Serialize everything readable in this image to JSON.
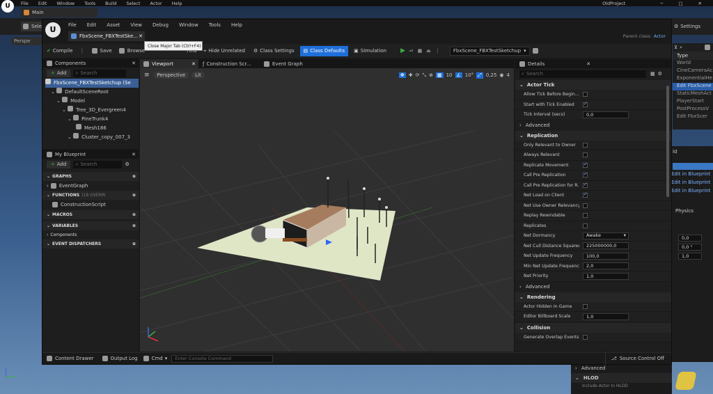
{
  "outer": {
    "menu": [
      "File",
      "Edit",
      "Window",
      "Tools",
      "Build",
      "Select",
      "Actor",
      "Help"
    ],
    "project": "OldProject",
    "tab": "Main",
    "select_label": "Sele",
    "perspective_label": "Perspe",
    "settings_label": "Settings",
    "outliner_header": "Type",
    "outliner_types": [
      "World",
      "CineCameraAc",
      "ExponentialHe",
      "Edit FbxScene",
      "StaticMeshAct",
      "PlayerStart",
      "PostProcessV",
      "Edit FbxScer"
    ],
    "right_labels": [
      "ld",
      "Edit in Blueprint",
      "Edit in Blueprint",
      "Edit in Blueprint",
      "Physics"
    ],
    "transform_values": [
      "0,0",
      "0,0 °",
      "1,0"
    ],
    "bottom_rows": [
      "Advanced",
      "HLOD",
      "Include Actor In HLOD"
    ]
  },
  "bp": {
    "menu": [
      "File",
      "Edit",
      "Asset",
      "View",
      "Debug",
      "Window",
      "Tools",
      "Help"
    ],
    "tab_title": "FbxScene_FBXTestSke...",
    "tooltip": "Close Major Tab (Ctrl+F4)",
    "parent_class_label": "Parent class:",
    "parent_class": "Actor",
    "toolbar": [
      "Compile",
      "Save",
      "Browse",
      "Find",
      "Hide Unrelated",
      "Class Settings",
      "Class Defaults",
      "Simulation"
    ],
    "debug_target": "FbxScene_FBXTestSketchup",
    "components": {
      "title": "Components",
      "add": "Add",
      "search": "Search",
      "tree": [
        "FbxScene_FBXTestSketchup (Se",
        "DefaultSceneRoot",
        "Model",
        "Tree_3D_Evergreen4",
        "PineTrunk4",
        "Mesh186",
        "Cluster_copy_007_3"
      ]
    },
    "myblueprint": {
      "title": "My Blueprint",
      "add": "Add",
      "search": "Search",
      "graphs": "GRAPHS",
      "event_graph": "EventGraph",
      "functions": "FUNCTIONS",
      "functions_count": "(18 OVERRI",
      "construction_script": "ConstructionScript",
      "macros": "MACROS",
      "variables": "VARIABLES",
      "components_cat": "Components",
      "dispatchers": "EVENT DISPATCHERS"
    },
    "tabs": [
      "Viewport",
      "Construction Scr...",
      "Event Graph"
    ],
    "viewport": {
      "perspective": "Perspective",
      "lit": "Lit",
      "grid": "10",
      "angle": "10°",
      "scale": "0,25",
      "cam": "4"
    },
    "details": {
      "title": "Details",
      "search": "Search",
      "actor_tick": "Actor Tick",
      "tick_rows": [
        [
          "Allow Tick Before Begin...",
          "chk",
          false
        ],
        [
          "Start with Tick Enabled",
          "chk",
          true
        ],
        [
          "Tick Interval (secs)",
          "val",
          "0,0"
        ]
      ],
      "advanced": "Advanced",
      "replication": "Replication",
      "repl_rows": [
        [
          "Only Relevant to Owner",
          "chk",
          false
        ],
        [
          "Always Relevant",
          "chk",
          false
        ],
        [
          "Replicate Movement",
          "chk",
          true
        ],
        [
          "Call Pre Replication",
          "chk",
          true
        ],
        [
          "Call Pre Replication for R...",
          "chk",
          true
        ],
        [
          "Net Load on Client",
          "chk",
          true
        ],
        [
          "Net Use Owner Relevancy",
          "chk",
          false
        ],
        [
          "Replay Rewindable",
          "chk",
          false
        ],
        [
          "Replicates",
          "chk",
          false
        ],
        [
          "Net Dormancy",
          "sel",
          "Awake"
        ],
        [
          "Net Cull Distance Squared",
          "val",
          "225000000,0"
        ],
        [
          "Net Update Frequency",
          "val",
          "100,0"
        ],
        [
          "Min Net Update Frequency",
          "val",
          "2,0"
        ],
        [
          "Net Priority",
          "val",
          "1,0"
        ]
      ],
      "advanced2": "Advanced",
      "rendering": "Rendering",
      "render_rows": [
        [
          "Actor Hidden In Game",
          "chk",
          false
        ],
        [
          "Editor Billboard Scale",
          "val",
          "1,0"
        ]
      ],
      "collision": "Collision",
      "coll_rows": [
        [
          "Generate Overlap Events...",
          "chk",
          false
        ]
      ]
    },
    "bottom": {
      "drawer": "Content Drawer",
      "log": "Output Log",
      "cmd": "Cmd",
      "console": "Enter Console Command",
      "source": "Source Control Off"
    }
  },
  "colors": {
    "accent": "#1e6fd9",
    "plane": "#dfe6c6"
  }
}
